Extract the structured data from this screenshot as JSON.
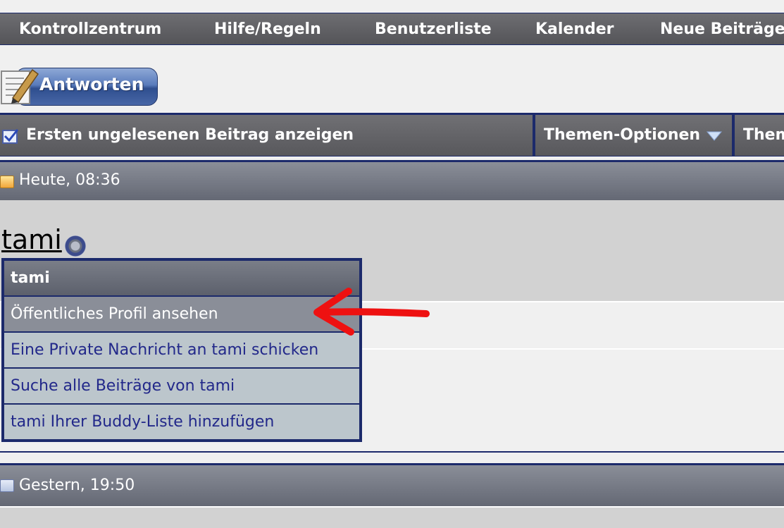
{
  "nav": {
    "items": [
      "Kontrollzentrum",
      "Hilfe/Regeln",
      "Benutzerliste",
      "Kalender",
      "Neue Beiträge"
    ]
  },
  "reply_button": {
    "label": "Antworten",
    "icon": "document-pen-icon"
  },
  "thread_toolbar": {
    "first_unread": "Ersten ungelesenen Beitrag anzeigen",
    "thread_options": "Themen-Optionen",
    "thread_cut": "Them"
  },
  "posts": [
    {
      "date": "Heute, 08:36",
      "icon": "post-new-icon"
    },
    {
      "date": "Gestern, 19:50",
      "icon": "post-old-icon"
    }
  ],
  "user": {
    "name": "tami",
    "status_icon": "offline-status-icon"
  },
  "user_menu": {
    "title": "tami",
    "items": [
      "Öffentliches Profil ansehen",
      "Eine Private Nachricht an tami schicken",
      "Suche alle Beiträge von tami",
      "tami Ihrer Buddy-Liste hinzufügen"
    ]
  },
  "colors": {
    "nav_bg": "#5e5e62",
    "border_navy": "#1c2a6b",
    "menu_item_text": "#22288a",
    "annotation_arrow": "#ee1111"
  }
}
